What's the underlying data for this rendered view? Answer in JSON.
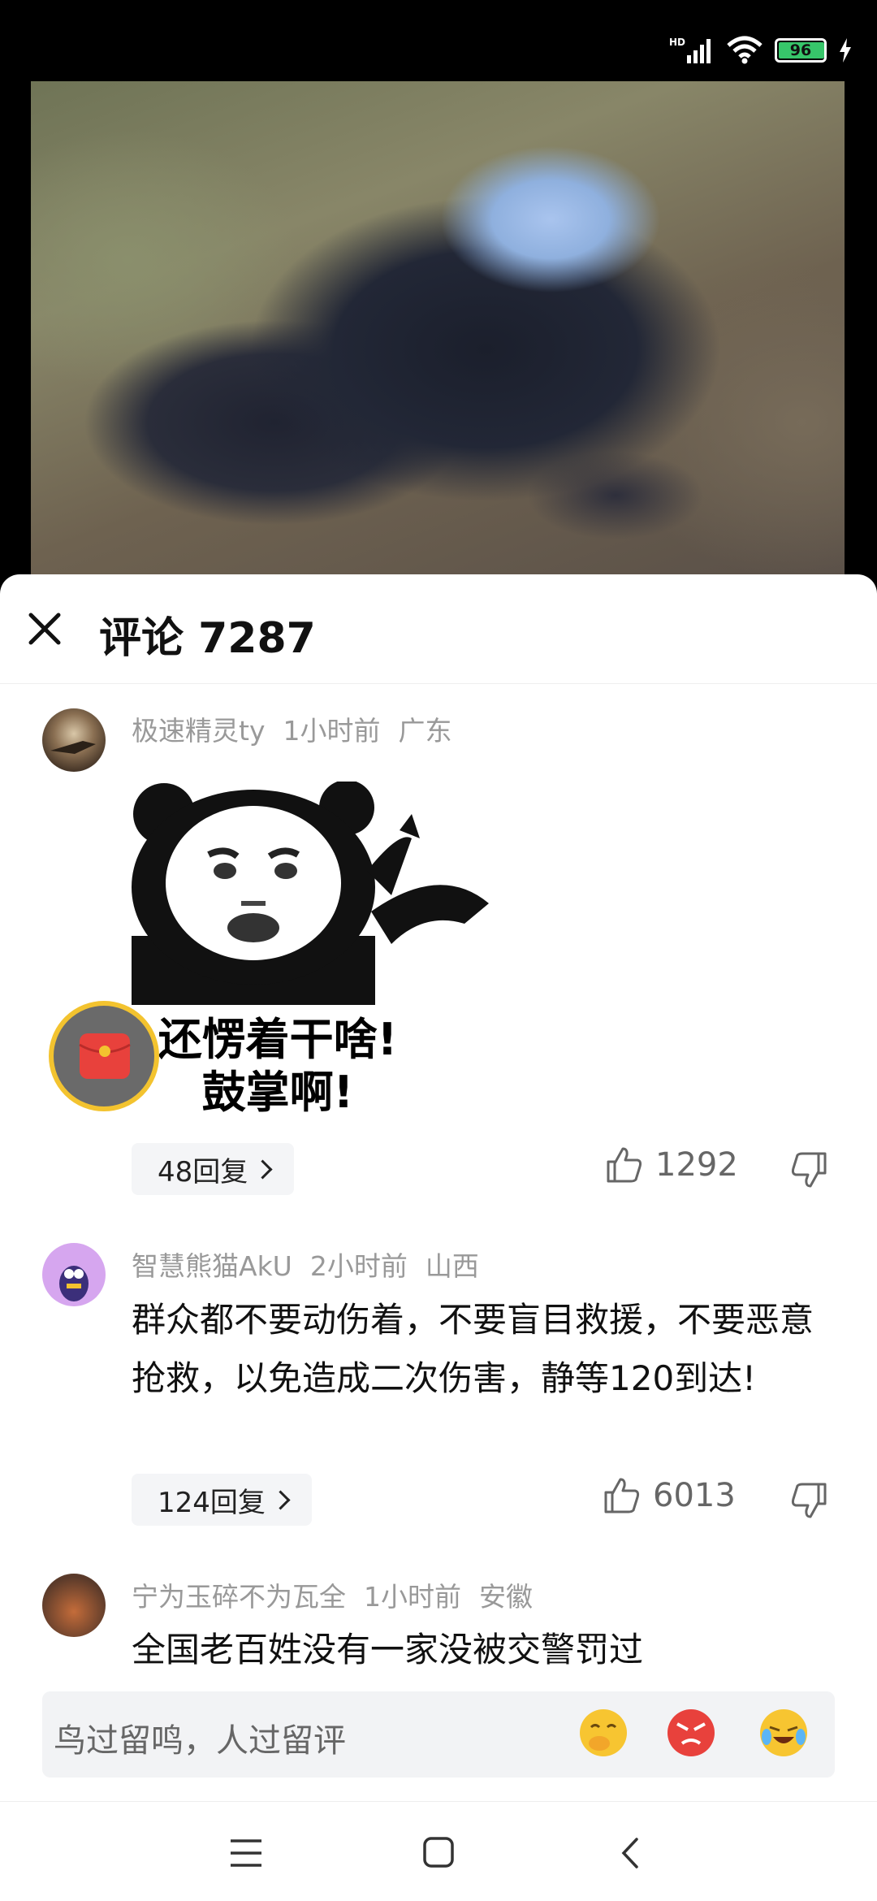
{
  "status_bar": {
    "network_type": "HD",
    "battery_level": "96",
    "charging": true
  },
  "comments_panel": {
    "title": "评论 7287",
    "comments": [
      {
        "username": "极速精灵ty",
        "time": "1小时前",
        "location": "广东",
        "sticker_caption_line1": "还愣着干啥!",
        "sticker_caption_line2": "鼓掌啊!",
        "replies_label": "48回复",
        "likes": "1292"
      },
      {
        "username": "智慧熊猫AkU",
        "time": "2小时前",
        "location": "山西",
        "text": "群众都不要动伤着，不要盲目救援，不要恶意抢救，以免造成二次伤害，静等120到达!",
        "replies_label": "124回复",
        "likes": "6013"
      },
      {
        "username": "宁为玉碎不为瓦全",
        "time": "1小时前",
        "location": "安徽",
        "text": "全国老百姓没有一家没被交警罚过"
      }
    ],
    "input_placeholder": "鸟过留鸣，人过留评",
    "emoji_quick": [
      "cover-mouth-emoji",
      "angry-emoji",
      "crying-laugh-emoji"
    ]
  },
  "colors": {
    "accent_battery": "#37c66a",
    "fab_ring": "#f3c32f",
    "red_packet": "#e8413c"
  }
}
